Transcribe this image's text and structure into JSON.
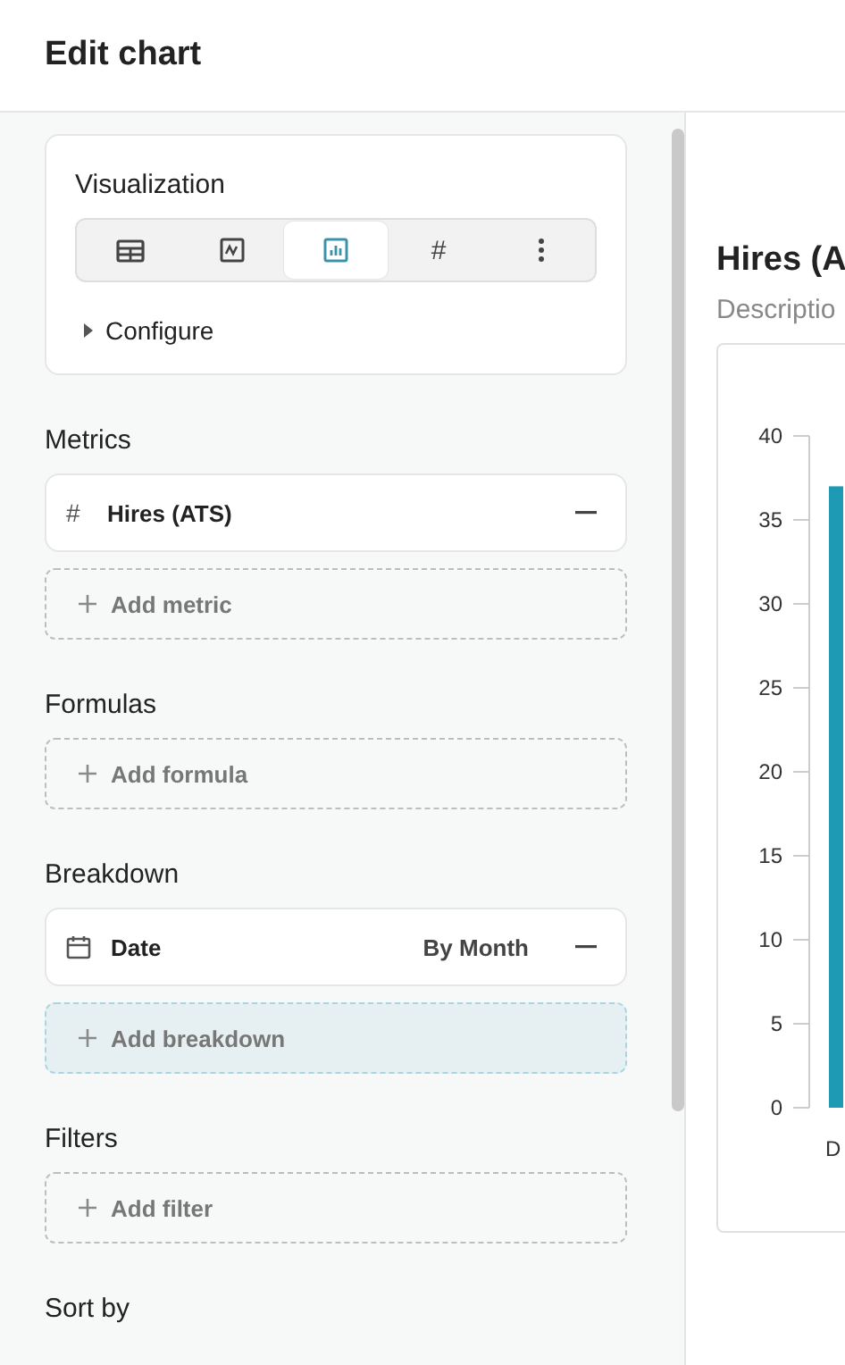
{
  "header": {
    "title": "Edit chart"
  },
  "visualization": {
    "title": "Visualization",
    "options": [
      {
        "kind": "table",
        "selected": false
      },
      {
        "kind": "line",
        "selected": false
      },
      {
        "kind": "bar",
        "selected": true
      },
      {
        "kind": "number",
        "label": "#",
        "selected": false
      },
      {
        "kind": "more",
        "selected": false
      }
    ],
    "configure": {
      "label": "Configure",
      "expanded": false
    }
  },
  "sections": [
    {
      "title": "Metrics",
      "items": [
        {
          "kind": "metric",
          "icon_text": "#",
          "label": "Hires (ATS)"
        }
      ],
      "add": {
        "label": "Add metric",
        "highlighted": false
      }
    },
    {
      "title": "Formulas",
      "add": {
        "label": "Add formula",
        "highlighted": false
      }
    },
    {
      "title": "Breakdown",
      "items": [
        {
          "kind": "date",
          "label": "Date",
          "value": "By Month"
        }
      ],
      "add": {
        "label": "Add breakdown",
        "highlighted": true
      }
    },
    {
      "title": "Filters",
      "add": {
        "label": "Add filter",
        "highlighted": false
      }
    },
    {
      "title": "Sort by"
    }
  ],
  "preview": {
    "title": "Hires (A",
    "description": "Descriptio",
    "chart_data": {
      "type": "bar",
      "categories": [
        "D"
      ],
      "values": [
        37
      ],
      "ylim": [
        0,
        40
      ],
      "yticks": [
        0,
        5,
        10,
        15,
        20,
        25,
        30,
        35,
        40
      ]
    }
  }
}
